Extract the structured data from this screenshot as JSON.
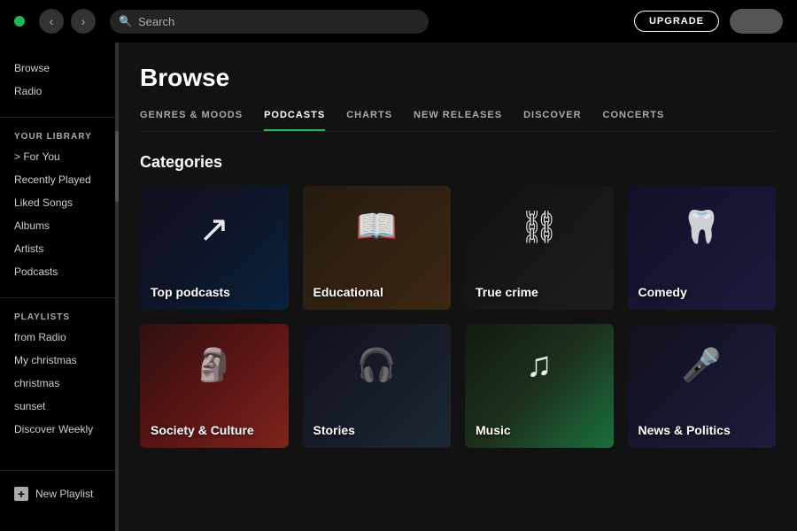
{
  "topbar": {
    "search_placeholder": "Search",
    "upgrade_label": "UPGRADE",
    "back_icon": "‹",
    "forward_icon": "›"
  },
  "sidebar": {
    "top_items": [
      {
        "label": "Browse",
        "active": false
      },
      {
        "label": "Radio",
        "active": false
      }
    ],
    "library_label": "YOUR LIBRARY",
    "library_items": [
      {
        "label": "> For You",
        "active": false
      },
      {
        "label": "Recently Played",
        "active": false
      },
      {
        "label": "Liked Songs",
        "active": false
      },
      {
        "label": "Albums",
        "active": false
      },
      {
        "label": "Artists",
        "active": false
      },
      {
        "label": "Podcasts",
        "active": false
      }
    ],
    "playlists_label": "PLAYLISTS",
    "playlist_items": [
      {
        "label": "from Radio",
        "active": false
      },
      {
        "label": "My christmas",
        "active": false
      },
      {
        "label": "christmas",
        "active": false
      },
      {
        "label": "sunset",
        "active": false
      },
      {
        "label": "Discover Weekly",
        "active": false
      }
    ],
    "new_playlist_label": "New Playlist",
    "new_playlist_icon": "+"
  },
  "content": {
    "title": "Browse",
    "tabs": [
      {
        "label": "GENRES & MOODS",
        "active": false
      },
      {
        "label": "PODCASTS",
        "active": true
      },
      {
        "label": "CHARTS",
        "active": false
      },
      {
        "label": "NEW RELEASES",
        "active": false
      },
      {
        "label": "DISCOVER",
        "active": false
      },
      {
        "label": "CONCERTS",
        "active": false
      }
    ],
    "categories_title": "Categories",
    "categories": [
      {
        "label": "Top podcasts",
        "icon": "↗",
        "bg": "bg-top-podcasts"
      },
      {
        "label": "Educational",
        "icon": "📖",
        "bg": "bg-educational"
      },
      {
        "label": "True crime",
        "icon": "⛓",
        "bg": "bg-true-crime"
      },
      {
        "label": "Comedy",
        "icon": "🦷",
        "bg": "bg-comedy"
      },
      {
        "label": "Society & Culture",
        "icon": "🗿",
        "bg": "bg-society"
      },
      {
        "label": "Stories",
        "icon": "🎧",
        "bg": "bg-stories"
      },
      {
        "label": "Music",
        "icon": "♪",
        "bg": "bg-music"
      },
      {
        "label": "News & Politics",
        "icon": "🎤",
        "bg": "bg-news"
      }
    ]
  }
}
